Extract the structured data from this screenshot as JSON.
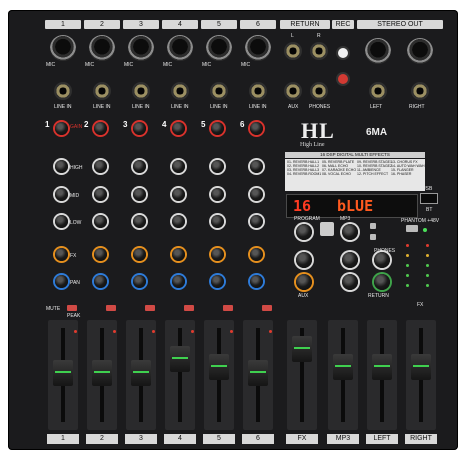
{
  "channel_headers": [
    "1",
    "2",
    "3",
    "4",
    "5",
    "6"
  ],
  "section_headers": {
    "return": "RETURN",
    "rec": "REC",
    "stereo_out": "STEREO OUT"
  },
  "labels": {
    "mic": "MIC",
    "line_in": "LINE IN",
    "return_l": "L",
    "return_r": "R",
    "aux": "AUX",
    "phones": "PHONES",
    "left": "LEFT",
    "right": "RIGHT",
    "gain": "GAIN",
    "high": "HIGH",
    "mid": "MID",
    "low": "LOW",
    "aux_knob": "AUX",
    "fx": "FX",
    "pan": "PAN",
    "mute": "MUTE",
    "peak": "PEAK",
    "program": "PROGRAM",
    "mp3": "MP3",
    "usb": "USB",
    "bt": "BT",
    "phantom": "PHANTOM +48V",
    "return_knob": "RETURN",
    "aux_out": "AUX",
    "phones_knob": "PHONES",
    "fx_label": "FX",
    "model": "6MA",
    "brand_sub": "High Line",
    "logo": "HL",
    "dsp_title": "16 DSP DIGITAL MULTI EFFECTS"
  },
  "display": {
    "number": "16",
    "text": "bLUE"
  },
  "fx_programs": [
    "01- REVERB HALL1",
    "02- REVERB HALL2",
    "03- REVERB HALL3",
    "04- REVERB ROOM1",
    "05- REVERB PLATE",
    "06- MALL ECHO",
    "07- KARAOKE ECHO",
    "08- VOCAL ECHO",
    "09- REVERB STAGE1",
    "10- REVERB STAGE2",
    "11- AMBIENCE",
    "12- PITCH EFFECT",
    "13- CHORUS FX",
    "14- AUTO WAH WAH",
    "15- FLANGER",
    "16- PHASER"
  ],
  "fader_labels": [
    "1",
    "2",
    "3",
    "4",
    "5",
    "6",
    "FX",
    "MP3",
    "LEFT",
    "RIGHT"
  ],
  "fader_levels": [
    0.55,
    0.55,
    0.55,
    0.72,
    0.62,
    0.55,
    0.85,
    0.62,
    0.62,
    0.62
  ]
}
